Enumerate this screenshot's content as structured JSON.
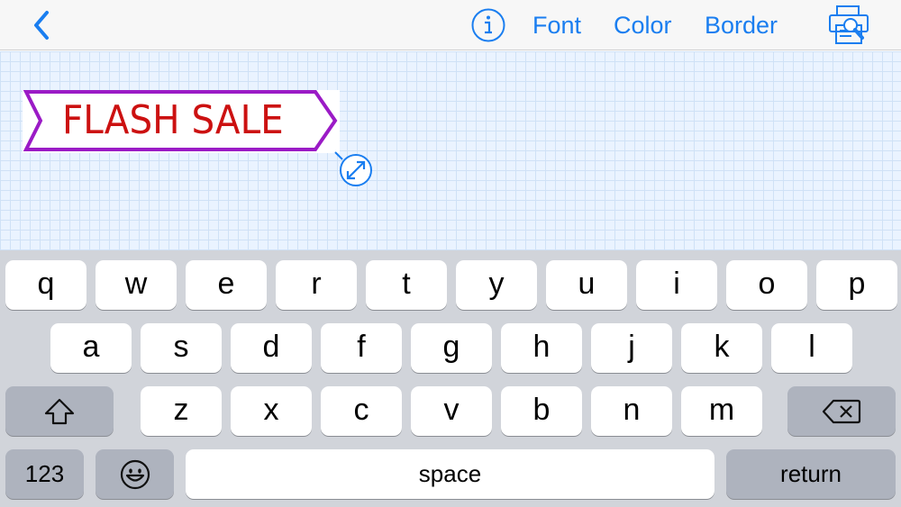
{
  "toolbar": {
    "back_icon": "chevron-left-icon",
    "info_icon": "info-circle-icon",
    "font_label": "Font",
    "color_label": "Color",
    "border_label": "Border",
    "print_icon": "print-preview-icon",
    "accent_color": "#1a7ef0"
  },
  "canvas": {
    "background": "#eaf3ff",
    "banner": {
      "text": "FLASH SALE",
      "text_color": "#cc1111",
      "border_color": "#9b1bc6"
    },
    "resize_icon": "resize-handle-icon"
  },
  "keyboard": {
    "row1": [
      "q",
      "w",
      "e",
      "r",
      "t",
      "y",
      "u",
      "i",
      "o",
      "p"
    ],
    "row2": [
      "a",
      "s",
      "d",
      "f",
      "g",
      "h",
      "j",
      "k",
      "l"
    ],
    "row3": [
      "z",
      "x",
      "c",
      "v",
      "b",
      "n",
      "m"
    ],
    "shift_icon": "shift-icon",
    "delete_icon": "delete-backspace-icon",
    "numbers_label": "123",
    "emoji_icon": "emoji-icon",
    "space_label": "space",
    "return_label": "return"
  }
}
